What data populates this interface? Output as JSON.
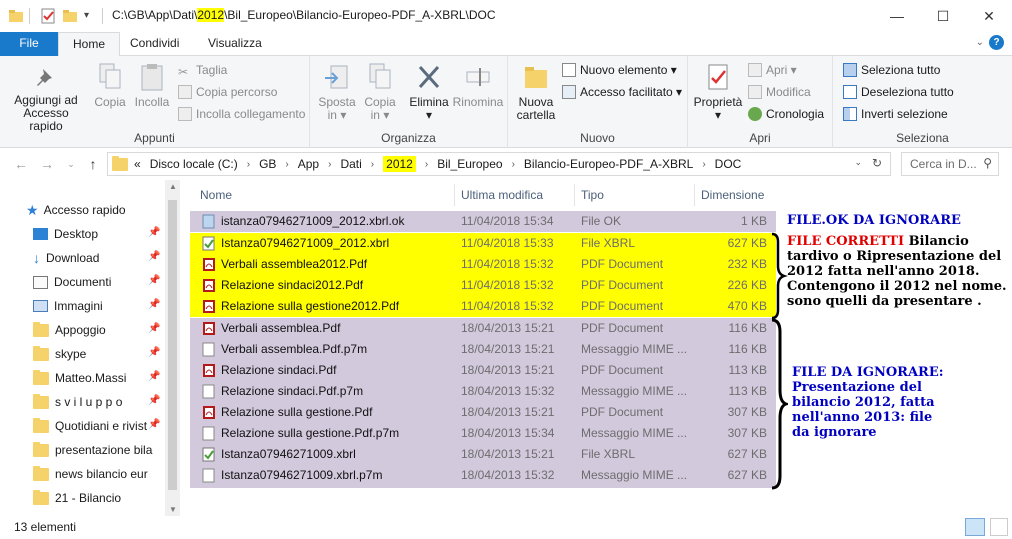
{
  "window": {
    "path_prefix": "C:\\GB\\App\\Dati\\",
    "path_highlight": "2012",
    "path_suffix": "\\Bil_Europeo\\Bilancio-Europeo-PDF_A-XBRL\\DOC",
    "minimize": "—",
    "maximize": "☐",
    "close": "✕"
  },
  "tabs": [
    {
      "label": "File"
    },
    {
      "label": "Home"
    },
    {
      "label": "Condividi"
    },
    {
      "label": "Visualizza"
    }
  ],
  "ribbon": {
    "appunti": {
      "label": "Appunti",
      "pin": "Aggiungi ad\nAccesso rapido",
      "copia": "Copia",
      "incolla": "Incolla",
      "taglia": "Taglia",
      "copia_percorso": "Copia percorso",
      "incolla_collegamento": "Incolla collegamento"
    },
    "organizza": {
      "label": "Organizza",
      "sposta": "Sposta\nin ▾",
      "copia_in": "Copia\nin ▾",
      "elimina": "Elimina\n▾",
      "rinomina": "Rinomina"
    },
    "nuovo": {
      "label": "Nuovo",
      "nuova_cartella": "Nuova\ncartella",
      "nuovo_elemento": "Nuovo elemento ▾",
      "accesso_facilitato": "Accesso facilitato ▾"
    },
    "apri": {
      "label": "Apri",
      "proprieta": "Proprietà\n▾",
      "apri": "Apri ▾",
      "modifica": "Modifica",
      "cronologia": "Cronologia"
    },
    "seleziona": {
      "label": "Seleziona",
      "seleziona_tutto": "Seleziona tutto",
      "deseleziona_tutto": "Deseleziona tutto",
      "inverti": "Inverti selezione"
    }
  },
  "address": {
    "overflow": "«",
    "crumbs": [
      "Disco locale (C:)",
      "GB",
      "App",
      "Dati",
      "2012",
      "Bil_Europeo",
      "Bilancio-Europeo-PDF_A-XBRL",
      "DOC"
    ],
    "search_placeholder": "Cerca in D..."
  },
  "nav": {
    "items": [
      {
        "label": "Accesso rapido"
      },
      {
        "label": "Desktop"
      },
      {
        "label": "Download"
      },
      {
        "label": "Documenti"
      },
      {
        "label": "Immagini"
      },
      {
        "label": "Appoggio"
      },
      {
        "label": "skype"
      },
      {
        "label": "Matteo.Massi"
      },
      {
        "label": "s v i l u p p o"
      },
      {
        "label": "Quotidiani e rivist"
      },
      {
        "label": "presentazione bila"
      },
      {
        "label": "news bilancio eur"
      },
      {
        "label": "21 - Bilancio"
      }
    ]
  },
  "columns": {
    "name": "Nome",
    "date": "Ultima modifica",
    "type": "Tipo",
    "size": "Dimensione"
  },
  "files": [
    {
      "name": "istanza07946271009_2012.xbrl.ok",
      "date": "11/04/2018 15:34",
      "type": "File OK",
      "size": "1 KB",
      "icon": "ok-file-icon"
    },
    {
      "name": "Istanza07946271009_2012.xbrl",
      "date": "11/04/2018 15:33",
      "type": "File XBRL",
      "size": "627 KB",
      "icon": "xbrl-file-icon"
    },
    {
      "name": "Verbali assemblea2012.Pdf",
      "date": "11/04/2018 15:32",
      "type": "PDF Document",
      "size": "232 KB",
      "icon": "pdf-file-icon"
    },
    {
      "name": "Relazione sindaci2012.Pdf",
      "date": "11/04/2018 15:32",
      "type": "PDF Document",
      "size": "226 KB",
      "icon": "pdf-file-icon"
    },
    {
      "name": "Relazione sulla gestione2012.Pdf",
      "date": "11/04/2018 15:32",
      "type": "PDF Document",
      "size": "470 KB",
      "icon": "pdf-file-icon"
    },
    {
      "name": "Verbali assemblea.Pdf",
      "date": "18/04/2013 15:21",
      "type": "PDF Document",
      "size": "116 KB",
      "icon": "pdf-file-icon"
    },
    {
      "name": "Verbali assemblea.Pdf.p7m",
      "date": "18/04/2013 15:21",
      "type": "Messaggio MIME ...",
      "size": "116 KB",
      "icon": "p7m-file-icon"
    },
    {
      "name": "Relazione sindaci.Pdf",
      "date": "18/04/2013 15:21",
      "type": "PDF Document",
      "size": "113 KB",
      "icon": "pdf-file-icon"
    },
    {
      "name": "Relazione sindaci.Pdf.p7m",
      "date": "18/04/2013 15:32",
      "type": "Messaggio MIME ...",
      "size": "113 KB",
      "icon": "p7m-file-icon"
    },
    {
      "name": "Relazione sulla gestione.Pdf",
      "date": "18/04/2013 15:21",
      "type": "PDF Document",
      "size": "307 KB",
      "icon": "pdf-file-icon"
    },
    {
      "name": "Relazione sulla gestione.Pdf.p7m",
      "date": "18/04/2013 15:34",
      "type": "Messaggio MIME ...",
      "size": "307 KB",
      "icon": "p7m-file-icon"
    },
    {
      "name": "Istanza07946271009.xbrl",
      "date": "18/04/2013 15:21",
      "type": "File XBRL",
      "size": "627 KB",
      "icon": "xbrl-file-icon"
    },
    {
      "name": "Istanza07946271009.xbrl.p7m",
      "date": "18/04/2013 15:32",
      "type": "Messaggio MIME ...",
      "size": "627 KB",
      "icon": "p7m-file-icon"
    }
  ],
  "annotations": {
    "ok": "FILE.OK DA IGNORARE",
    "corretti_red": "FILE CORRETTI",
    "corretti_rest_1": " Bilancio",
    "corretti_lines": [
      "tardivo o Ripresentazione del",
      "2012 fatta nell'anno 2018.",
      "Contengono il 2012 nel nome.",
      "sono quelli da presentare ."
    ],
    "ignorare_lines": [
      "FILE DA IGNORARE:",
      "Presentazione del",
      "bilancio 2012, fatta",
      "nell'anno 2013: file",
      "da ignorare"
    ]
  },
  "status": {
    "count": "13 elementi"
  },
  "colors": {
    "yellow": "#ffff00",
    "lavender": "#d2c9dd",
    "file_tab": "#1979ca",
    "annotation_blue": "#0000c0",
    "annotation_red": "#e00000"
  }
}
